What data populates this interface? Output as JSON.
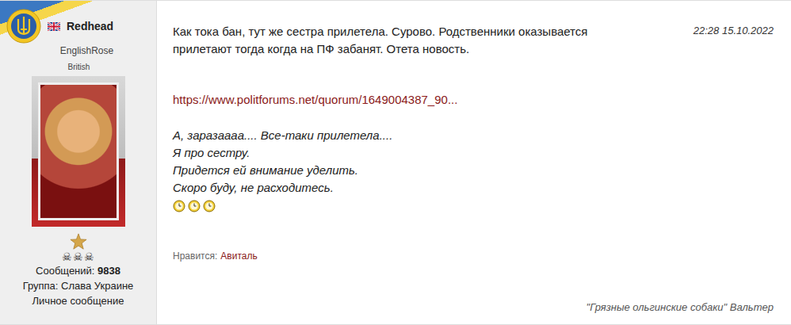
{
  "user": {
    "name": "Redhead",
    "nick": "EnglishRose",
    "country": "British",
    "rank": "☠☠☠",
    "posts_label": "Сообщений:",
    "posts": "9838",
    "group_label": "Группа:",
    "group": "Слава Украине",
    "pm": "Личное сообщение"
  },
  "post": {
    "time": "22:28 15.10.2022",
    "text_lines": [
      "Как тока бан, тут же сестра прилетела. Сурово. Родственники оказывается",
      "прилетают тогда когда на ПФ забанят. Отета новость."
    ],
    "link": "https://www.politforums.net/quorum/1649004387_90...",
    "quote_lines": [
      "А, заразаааа.... Все-таки прилетела....",
      "Я про сестру.",
      "Придется ей внимание уделить.",
      "Скоро буду, не расходитесь."
    ]
  },
  "likes": {
    "label": "Нравится:",
    "names": [
      "Авиталь"
    ]
  },
  "signature": "\"Грязные ольгинские собаки\" Вальтер"
}
